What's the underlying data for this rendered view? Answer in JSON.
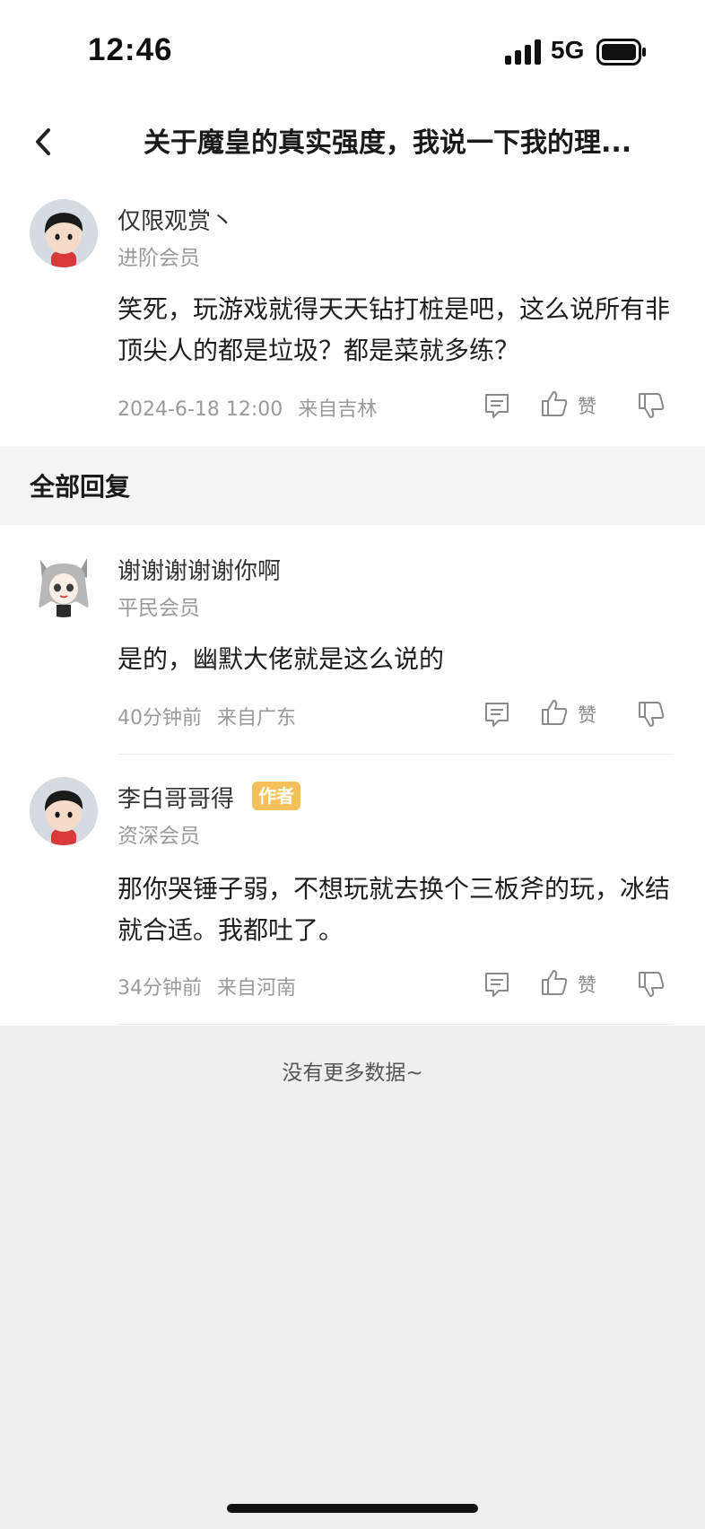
{
  "status": {
    "time": "12:46",
    "network": "5G"
  },
  "nav": {
    "title": "关于魔皇的真实强度，我说一下我的理..."
  },
  "main_comment": {
    "username": "仅限观赏丶",
    "level": "进阶会员",
    "text": "笑死，玩游戏就得天天钻打桩是吧，这么说所有非顶尖人的都是垃圾？都是菜就多练？",
    "time": "2024-6-18 12:00",
    "location": "来自吉林",
    "like_label": "赞"
  },
  "replies_section": {
    "title": "全部回复"
  },
  "replies": [
    {
      "username": "谢谢谢谢谢你啊",
      "level": "平民会员",
      "text": "是的，幽默大佬就是这么说的",
      "time": "40分钟前",
      "location": "来自广东",
      "like_label": "赞"
    },
    {
      "username": "李白哥哥得",
      "badge": "作者",
      "level": "资深会员",
      "text": "那你哭锤子弱，不想玩就去换个三板斧的玩，冰结就合适。我都吐了。",
      "time": "34分钟前",
      "location": "来自河南",
      "like_label": "赞"
    }
  ],
  "footer": {
    "no_more": "没有更多数据~"
  },
  "icons": {
    "back": "chevron-left-icon",
    "reply": "comment-icon",
    "like": "thumbs-up-icon",
    "dislike": "thumbs-down-icon",
    "signal": "signal-bars-icon",
    "battery": "battery-icon"
  },
  "colors": {
    "author_badge": "#f6c15a",
    "section_band": "#f5f5f5",
    "page_bg": "#efefef"
  }
}
